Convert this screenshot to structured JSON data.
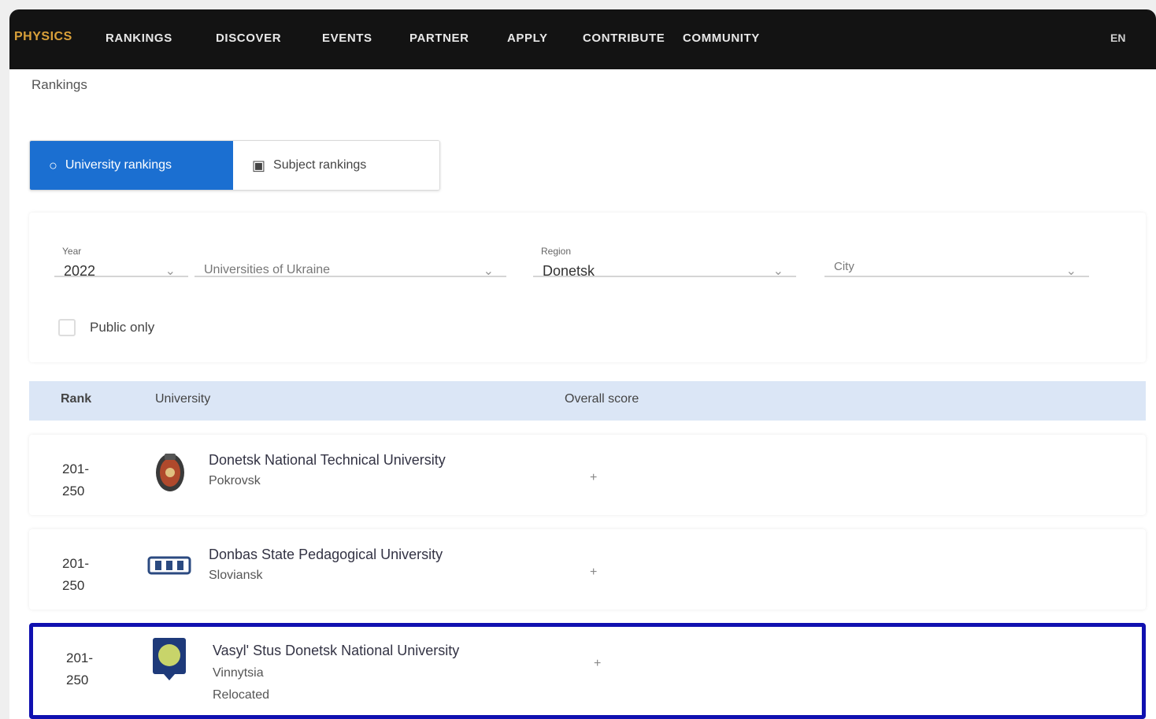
{
  "nav": {
    "logo": "PHYSICS",
    "items": [
      "RANKINGS",
      "DISCOVER",
      "EVENTS",
      "PARTNER",
      "APPLY",
      "CONTRIBUTE",
      "COMMUNITY"
    ],
    "lang": "EN"
  },
  "breadcrumb": "Rankings",
  "toggle": {
    "active_label": "University rankings",
    "inactive_label": "Subject rankings"
  },
  "filters": {
    "year_label": "Year",
    "year_value": "2022",
    "ranking_value": "Universities of Ukraine",
    "region_label": "Region",
    "region_value": "Donetsk",
    "city_placeholder": "City",
    "checkbox_label": "Public only"
  },
  "table": {
    "headers": {
      "rank": "Rank",
      "university": "University",
      "overall": "Overall score"
    },
    "rows": [
      {
        "rank": "201-\n250",
        "name": "Donetsk National Technical University",
        "sub": "Pokrovsk",
        "overall": "+",
        "logo": "university-crest-icon"
      },
      {
        "rank": "201-\n250",
        "name": "Donbas State Pedagogical University",
        "sub": "Sloviansk",
        "overall": "+",
        "logo": "university-emblem-icon"
      },
      {
        "rank": "201-\n250",
        "name": "Vasyl' Stus Donetsk National University",
        "sub": "Vinnytsia",
        "sub2": "Relocated",
        "overall": "+",
        "logo": "university-shield-icon"
      }
    ]
  },
  "colors": {
    "accent": "#1b6fd1",
    "navbar": "#131313",
    "highlight": "#1010b0",
    "table_header": "#dbe6f6"
  }
}
